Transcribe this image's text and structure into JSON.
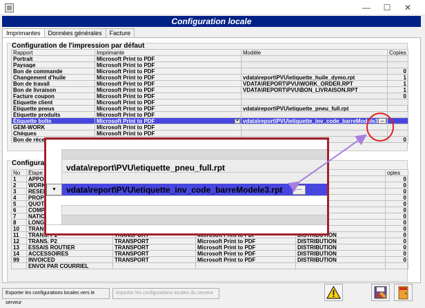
{
  "window": {
    "minimize": "—",
    "maximize": "☐",
    "close": "✕"
  },
  "header": {
    "title": "Configuration locale"
  },
  "tabs": [
    "Imprimantes",
    "Données générales",
    "Facture"
  ],
  "print_config": {
    "title": "Configuration de l'impression par défaut",
    "columns": [
      "Rapport",
      "Imprimante",
      "Modèle",
      "Copies"
    ],
    "rows": [
      {
        "rapport": "Portrait",
        "imprimante": "Microsoft Print to PDF",
        "modele": "",
        "copies": ""
      },
      {
        "rapport": "Paysage",
        "imprimante": "Microsoft Print to PDF",
        "modele": "",
        "copies": ""
      },
      {
        "rapport": "Bon de commande",
        "imprimante": "Microsoft Print to PDF",
        "modele": "",
        "copies": "0"
      },
      {
        "rapport": "Changement d'huile",
        "imprimante": "Microsoft Print to PDF",
        "modele": "vdata\\report\\PVU\\etiquette_huile_dymo.rpt",
        "copies": "1"
      },
      {
        "rapport": "Bon de travail",
        "imprimante": "Microsoft Print to PDF",
        "modele": "VDATA\\REPORT\\PVU\\WORK_ORDER.RPT",
        "copies": "1"
      },
      {
        "rapport": "Bon de livraison",
        "imprimante": "Microsoft Print to PDF",
        "modele": "VDATA\\REPORT\\PVU\\BON_LIVRAISON.RPT",
        "copies": "1"
      },
      {
        "rapport": "Facture coupon",
        "imprimante": "Microsoft Print to PDF",
        "modele": "",
        "copies": "0"
      },
      {
        "rapport": "Étiquette client",
        "imprimante": "Microsoft Print to PDF",
        "modele": "",
        "copies": ""
      },
      {
        "rapport": "Étiquette pneus",
        "imprimante": "Microsoft Print to PDF",
        "modele": "vdata\\report\\PVU\\etiquette_pneu_full.rpt",
        "copies": ""
      },
      {
        "rapport": "Étiquette produits",
        "imprimante": "Microsoft Print to PDF",
        "modele": "",
        "copies": ""
      },
      {
        "rapport": "Étiquette boîte",
        "imprimante": "Microsoft Print to PDF",
        "modele": "vdata\\report\\PVU\\etiquette_inv_code_barreModele3.rpt",
        "copies": ""
      },
      {
        "rapport": "GEM-WORK",
        "imprimante": "Microsoft Print to PDF",
        "modele": "",
        "copies": ""
      },
      {
        "rapport": "Chèques",
        "imprimante": "Microsoft Print to PDF",
        "modele": "",
        "copies": ""
      },
      {
        "rapport": "Bon de récep",
        "imprimante": "",
        "modele": "",
        "copies": "0"
      }
    ]
  },
  "second_config": {
    "title": "Configura",
    "columns": [
      "No",
      "Étape",
      "",
      "",
      "",
      "opies"
    ],
    "rows": [
      {
        "no": "1",
        "etape": "APPOI",
        "c2": "",
        "c3": "",
        "c4": "",
        "copies": "0"
      },
      {
        "no": "2",
        "etape": "WORK",
        "c2": "",
        "c3": "",
        "c4": "",
        "copies": "0"
      },
      {
        "no": "3",
        "etape": "RESER",
        "c2": "",
        "c3": "",
        "c4": "",
        "copies": "0"
      },
      {
        "no": "4",
        "etape": "PROPO",
        "c2": "",
        "c3": "",
        "c4": "",
        "copies": "0"
      },
      {
        "no": "5",
        "etape": "QUOTA",
        "c2": "",
        "c3": "",
        "c4": "",
        "copies": "0"
      },
      {
        "no": "6",
        "etape": "COMPI",
        "c2": "",
        "c3": "",
        "c4": "",
        "copies": "0"
      },
      {
        "no": "7",
        "etape": "NATIO",
        "c2": "",
        "c3": "",
        "c4": "",
        "copies": "0"
      },
      {
        "no": "8",
        "etape": "LONG",
        "c2": "",
        "c3": "",
        "c4": "",
        "copies": "0"
      },
      {
        "no": "10",
        "etape": "TRANS",
        "c2": "",
        "c3": "",
        "c4": "",
        "copies": "0"
      },
      {
        "no": "11",
        "etape": "TRANS. P1",
        "c2": "TRANSPORT",
        "c3": "Microsoft Print to PDF",
        "c4": "DISTRIBUTION",
        "copies": "0"
      },
      {
        "no": "12",
        "etape": "TRANS. P2",
        "c2": "TRANSPORT",
        "c3": "Microsoft Print to PDF",
        "c4": "DISTRIBUTION",
        "copies": "0"
      },
      {
        "no": "13",
        "etape": "ESSAIS ROUTIER",
        "c2": "TRANSPORT",
        "c3": "Microsoft Print to PDF",
        "c4": "DISTRIBUTION",
        "copies": "0"
      },
      {
        "no": "14",
        "etape": "ACCESSOIRES",
        "c2": "TRANSPORT",
        "c3": "Microsoft Print to PDF",
        "c4": "DISTRIBUTION",
        "copies": "0"
      },
      {
        "no": "99",
        "etape": "INVOICED",
        "c2": "TRANSPORT",
        "c3": "Microsoft Print to PDF",
        "c4": "DISTRIBUTION",
        "copies": "0"
      },
      {
        "no": "",
        "etape": "ENVOI PAR COURRIEL",
        "c2": "",
        "c3": "",
        "c4": "",
        "copies": ""
      }
    ]
  },
  "zoom": {
    "line1": "vdata\\report\\PVU\\etiquette_pneu_full.rpt",
    "line2": "vdata\\report\\PVU\\etiquette_inv_code_barreModele3.rpt",
    "browse": "..."
  },
  "footer": {
    "export_label": "Exporter les configurations locales vers le serveur",
    "import_label": "Importer les configurations locales du serveur"
  },
  "colors": {
    "header_bg": "#032287",
    "selection": "#4747e0",
    "zoom_border": "#a3202a",
    "arrow": "#a87fe0",
    "circle": "#e02020"
  }
}
